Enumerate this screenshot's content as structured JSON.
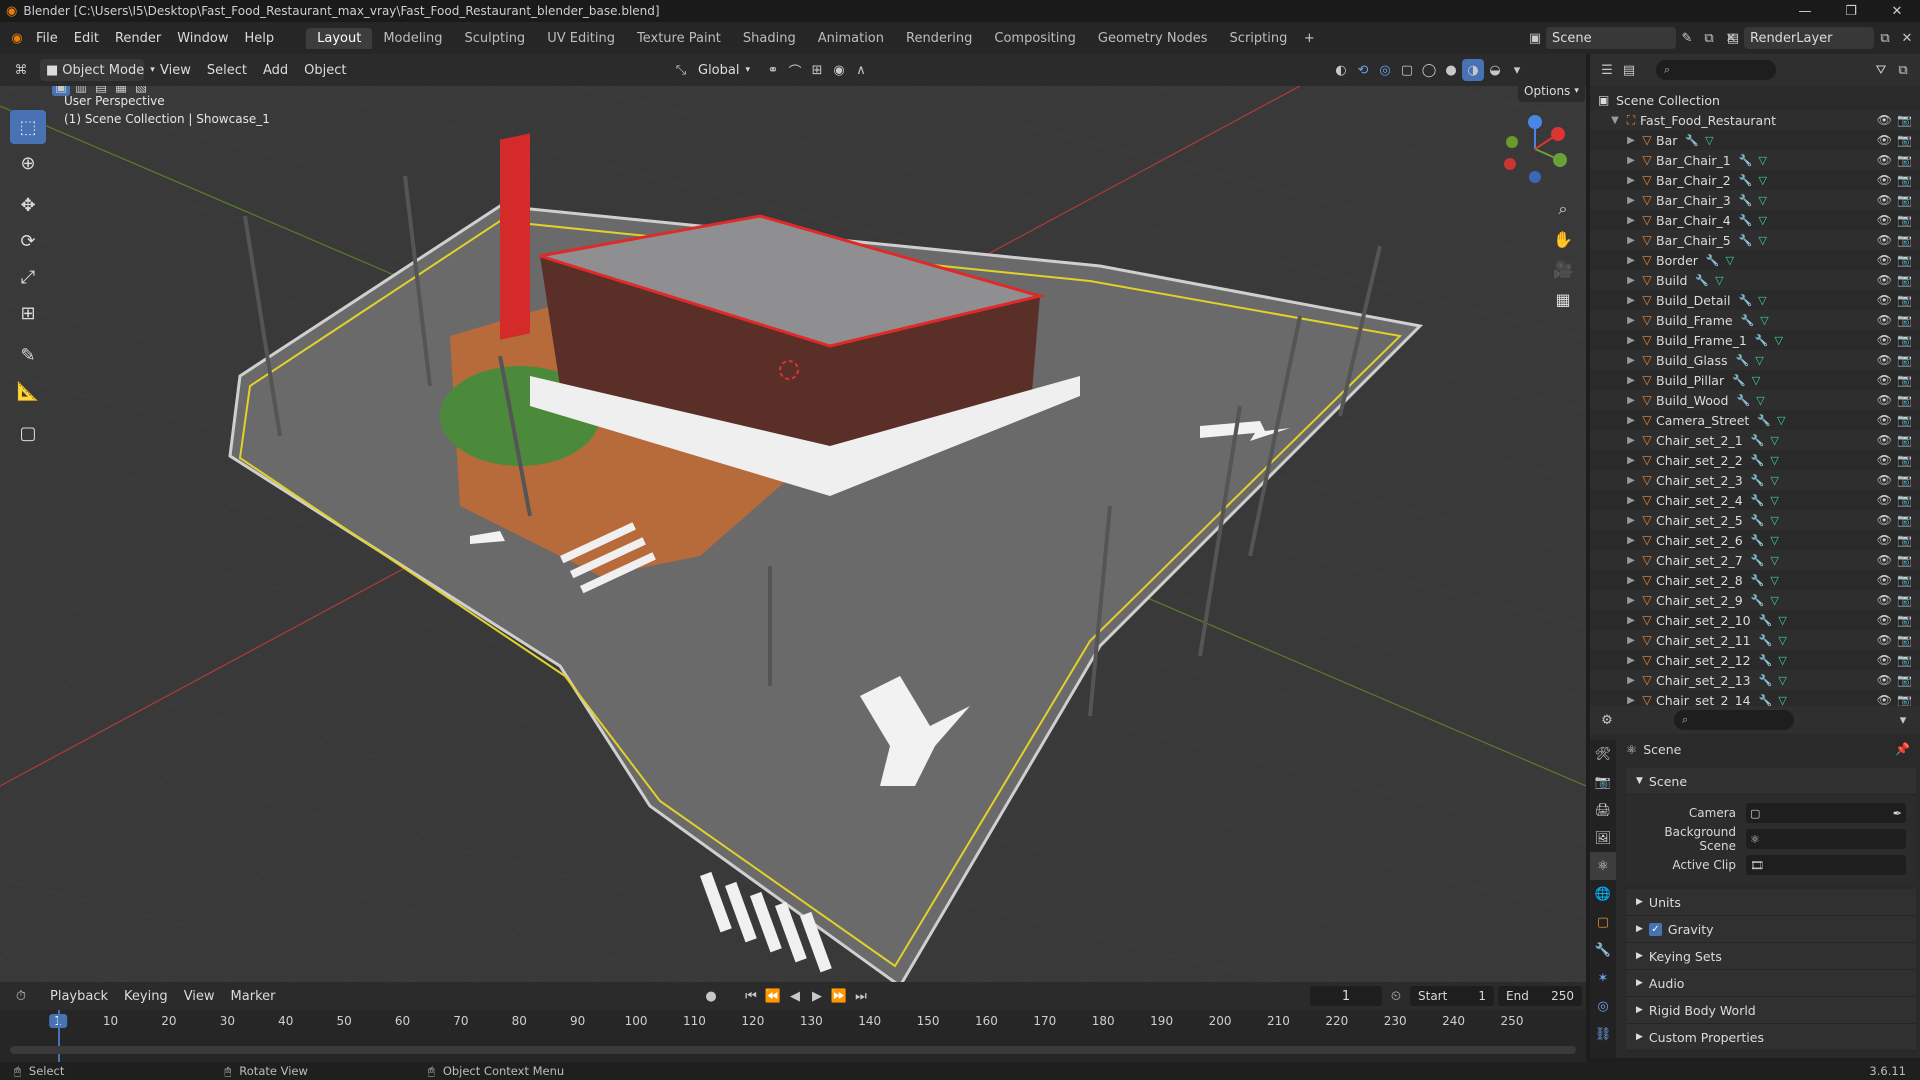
{
  "window": {
    "title": "Blender [C:\\Users\\I5\\Desktop\\Fast_Food_Restaurant_max_vray\\Fast_Food_Restaurant_blender_base.blend]"
  },
  "menu": {
    "items": [
      "File",
      "Edit",
      "Render",
      "Window",
      "Help"
    ],
    "workspaces": [
      "Layout",
      "Modeling",
      "Sculpting",
      "UV Editing",
      "Texture Paint",
      "Shading",
      "Animation",
      "Rendering",
      "Compositing",
      "Geometry Nodes",
      "Scripting"
    ],
    "active_workspace": "Layout",
    "scene_name": "Scene",
    "render_layer": "RenderLayer"
  },
  "viewport_header": {
    "mode": "Object Mode",
    "menus": [
      "View",
      "Select",
      "Add",
      "Object"
    ],
    "transform_orientation": "Global",
    "options_label": "Options"
  },
  "viewport": {
    "perspective_label": "User Perspective",
    "collection_label": "(1) Scene Collection | Showcase_1"
  },
  "outliner": {
    "root": "Scene Collection",
    "collection": "Fast_Food_Restaurant",
    "objects": [
      "Bar",
      "Bar_Chair_1",
      "Bar_Chair_2",
      "Bar_Chair_3",
      "Bar_Chair_4",
      "Bar_Chair_5",
      "Border",
      "Build",
      "Build_Detail",
      "Build_Frame",
      "Build_Frame_1",
      "Build_Glass",
      "Build_Pillar",
      "Build_Wood",
      "Camera_Street",
      "Chair_set_2_1",
      "Chair_set_2_2",
      "Chair_set_2_3",
      "Chair_set_2_4",
      "Chair_set_2_5",
      "Chair_set_2_6",
      "Chair_set_2_7",
      "Chair_set_2_8",
      "Chair_set_2_9",
      "Chair_set_2_10",
      "Chair_set_2_11",
      "Chair_set_2_12",
      "Chair_set_2_13",
      "Chair_set_2_14"
    ]
  },
  "properties": {
    "context": "Scene",
    "section": "Scene",
    "fields": {
      "camera_label": "Camera",
      "background_scene_label": "Background Scene",
      "active_clip_label": "Active Clip"
    },
    "panels": [
      "Units",
      "Gravity",
      "Keying Sets",
      "Audio",
      "Rigid Body World",
      "Custom Properties"
    ],
    "gravity_checked": true
  },
  "timeline": {
    "menus": [
      "Playback",
      "Keying",
      "View",
      "Marker"
    ],
    "current_frame": "1",
    "start_label": "Start",
    "start_value": "1",
    "end_label": "End",
    "end_value": "250",
    "ticks": [
      "1",
      "10",
      "20",
      "30",
      "40",
      "50",
      "60",
      "70",
      "80",
      "90",
      "100",
      "110",
      "120",
      "130",
      "140",
      "150",
      "160",
      "170",
      "180",
      "190",
      "200",
      "210",
      "220",
      "230",
      "240",
      "250"
    ]
  },
  "statusbar": {
    "select": "Select",
    "rotate": "Rotate View",
    "context_menu": "Object Context Menu",
    "version": "3.6.11"
  },
  "colors": {
    "accent": "#4772b3",
    "object_icon": "#e8893a",
    "mesh_icon": "#3fd1a0",
    "axis_red": "#c73a3a",
    "axis_green": "#6a9a2a"
  }
}
